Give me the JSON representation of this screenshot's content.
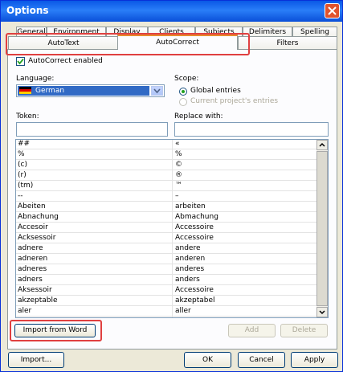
{
  "window": {
    "title": "Options"
  },
  "tabs_row1": [
    "General",
    "Environment",
    "Display",
    "Clients",
    "Subjects",
    "Delimiters",
    "Spelling"
  ],
  "tabs_row2": [
    "AutoText",
    "AutoCorrect",
    "Filters"
  ],
  "active_tab": "AutoCorrect",
  "autocorrect": {
    "enabled_label": "AutoCorrect enabled",
    "enabled": true,
    "language_label": "Language:",
    "language_value": "German",
    "scope_label": "Scope:",
    "scope_global": "Global entries",
    "scope_project": "Current project's entries",
    "token_label": "Token:",
    "replace_label": "Replace with:",
    "token_value": "",
    "replace_value": ""
  },
  "entries": [
    {
      "token": "##",
      "replace": "«"
    },
    {
      "token": "%",
      "replace": "%"
    },
    {
      "token": "(c)",
      "replace": "©"
    },
    {
      "token": "(r)",
      "replace": "®"
    },
    {
      "token": "(tm)",
      "replace": "™"
    },
    {
      "token": "--",
      "replace": "–"
    },
    {
      "token": "Abeiten",
      "replace": "arbeiten"
    },
    {
      "token": "Abnachung",
      "replace": "Abmachung"
    },
    {
      "token": "Accesoir",
      "replace": "Accessoire"
    },
    {
      "token": "Acksessoir",
      "replace": "Accessoire"
    },
    {
      "token": "adnere",
      "replace": "andere"
    },
    {
      "token": "adneren",
      "replace": "anderen"
    },
    {
      "token": "adneres",
      "replace": "anderes"
    },
    {
      "token": "adners",
      "replace": "anders"
    },
    {
      "token": "Aksessoir",
      "replace": "Accessoire"
    },
    {
      "token": "akzeptable",
      "replace": "akzeptabel"
    },
    {
      "token": "aler",
      "replace": "aller"
    }
  ],
  "buttons": {
    "import_word": "Import from Word",
    "add": "Add",
    "delete": "Delete",
    "import": "Import...",
    "ok": "OK",
    "cancel": "Cancel",
    "apply": "Apply"
  },
  "colors": {
    "highlight_box": "#e04040",
    "selection": "#316ac5"
  }
}
